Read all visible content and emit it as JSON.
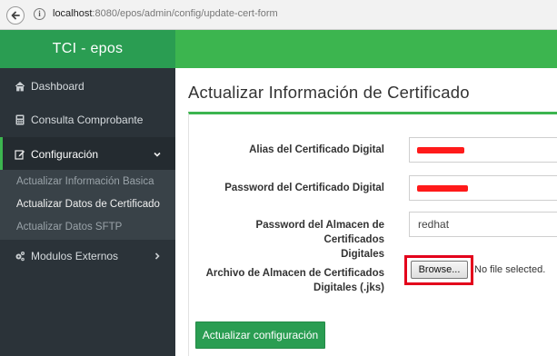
{
  "browser": {
    "url_host": "localhost",
    "url_rest": ":8080/epos/admin/config/update-cert-form"
  },
  "header": {
    "brand": "TCI - epos"
  },
  "sidebar": {
    "items": [
      {
        "label": "Dashboard",
        "icon": "home-icon"
      },
      {
        "label": "Consulta Comprobante",
        "icon": "calculator-icon"
      },
      {
        "label": "Configuración",
        "icon": "edit-icon"
      },
      {
        "label": "Modulos Externos",
        "icon": "cogs-icon"
      }
    ],
    "submenu": [
      {
        "label": "Actualizar Información Basica"
      },
      {
        "label": "Actualizar Datos de Certificado"
      },
      {
        "label": "Actualizar Datos SFTP"
      }
    ]
  },
  "main": {
    "title": "Actualizar Información de Certificado",
    "form": {
      "alias_label": "Alias del Certificado Digital",
      "password_label": "Password del Certificado Digital",
      "store_password_label_1": "Password del Almacen de Certificados",
      "store_password_label_2": "Digitales",
      "store_password_value": "redhat",
      "file_label_1": "Archivo de Almacen de Certificados",
      "file_label_2": "Digitales (.jks)",
      "browse_label": "Browse...",
      "no_file_text": "No file selected.",
      "submit_label": "Actualizar configuración"
    }
  },
  "colors": {
    "brand_green": "#2a9d52",
    "topbar_green": "#3cb54f",
    "sidebar_bg": "#2b3339",
    "redaction": "#ff1a1a",
    "highlight": "#e3001b"
  }
}
